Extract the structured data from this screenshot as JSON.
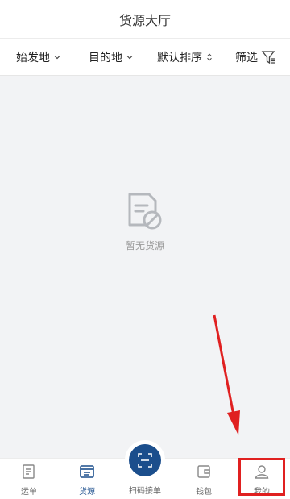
{
  "header": {
    "title": "货源大厅"
  },
  "filters": [
    {
      "label": "始发地"
    },
    {
      "label": "目的地"
    },
    {
      "label": "默认排序"
    },
    {
      "label": "筛选"
    }
  ],
  "empty_state": {
    "text": "暂无货源",
    "icon": "document-forbidden-icon"
  },
  "tabbar": {
    "items": [
      {
        "label": "运单",
        "icon": "waybill-icon"
      },
      {
        "label": "货源",
        "icon": "cargo-icon",
        "active": true
      },
      {
        "label": "扫码接单",
        "icon": "scan-icon"
      },
      {
        "label": "钱包",
        "icon": "wallet-icon"
      },
      {
        "label": "我的",
        "icon": "person-icon"
      }
    ]
  },
  "colors": {
    "accent": "#1b4e8c",
    "annotation": "#e02020"
  }
}
